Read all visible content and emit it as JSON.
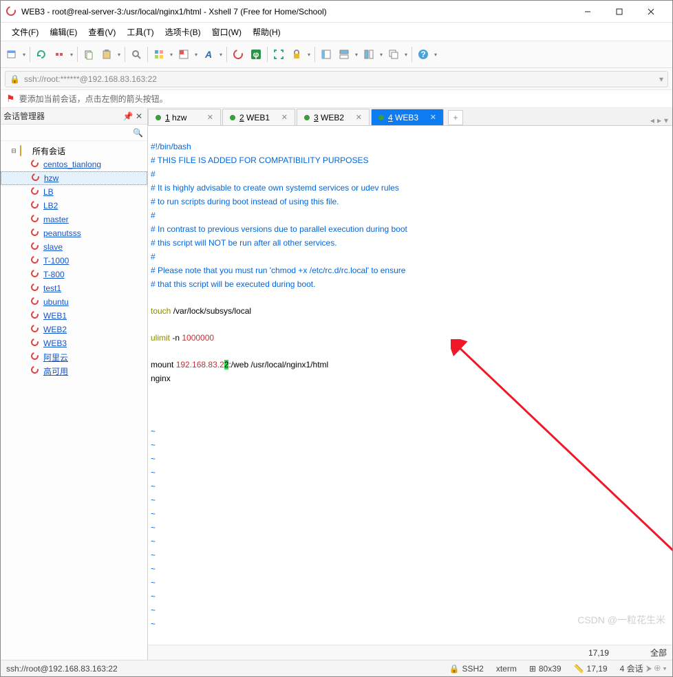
{
  "window": {
    "title": "WEB3 - root@real-server-3:/usr/local/nginx1/html - Xshell 7 (Free for Home/School)"
  },
  "menubar": [
    "文件(F)",
    "编辑(E)",
    "查看(V)",
    "工具(T)",
    "选项卡(B)",
    "窗口(W)",
    "帮助(H)"
  ],
  "address": "ssh://root:******@192.168.83.163:22",
  "hint": "要添加当前会话，点击左侧的箭头按钮。",
  "sidepanel": {
    "title": "会话管理器"
  },
  "tree": {
    "root": "所有会话",
    "items": [
      "centos_tianlong",
      "hzw",
      "LB",
      "LB2",
      "master",
      "peanutsss",
      "slave",
      "T-1000",
      "T-800",
      "test1",
      "ubuntu",
      "WEB1",
      "WEB2",
      "WEB3",
      "阿里云",
      "高可用"
    ],
    "selected": "hzw"
  },
  "tabs": [
    {
      "num": "1",
      "label": "hzw",
      "active": false
    },
    {
      "num": "2",
      "label": "WEB1",
      "active": false
    },
    {
      "num": "3",
      "label": "WEB2",
      "active": false
    },
    {
      "num": "4",
      "label": "WEB3",
      "active": true
    }
  ],
  "terminal": {
    "l1": "#!/bin/bash",
    "l2": "# THIS FILE IS ADDED FOR COMPATIBILITY PURPOSES",
    "l3": "#",
    "l4": "# It is highly advisable to create own systemd services or udev rules",
    "l5": "# to run scripts during boot instead of using this file.",
    "l6": "#",
    "l7": "# In contrast to previous versions due to parallel execution during boot",
    "l8": "# this script will NOT be run after all other services.",
    "l9": "#",
    "l10": "# Please note that you must run 'chmod +x /etc/rc.d/rc.local' to ensure",
    "l11": "# that this script will be executed during boot.",
    "touch_cmd": "touch",
    "touch_arg": " /var/lock/subsys/local",
    "ulimit_cmd": "ulimit",
    "ulimit_flag": " -n ",
    "ulimit_val": "1000000",
    "mount_cmd": "mount ",
    "mount_ip": "192.168.83.2",
    "mount_cursor": "2",
    "mount_rest": ":/web /usr/local/nginx1/html",
    "nginx": "nginx",
    "tilde": "~"
  },
  "statrow": {
    "pos": "17,19",
    "mode": "全部"
  },
  "status": {
    "conn": "ssh://root@192.168.83.163:22",
    "proto": "SSH2",
    "term": "xterm",
    "size": "80x39",
    "cursor": "17,19",
    "sessions": "4 会话"
  },
  "watermark": "CSDN @一粒花生米"
}
